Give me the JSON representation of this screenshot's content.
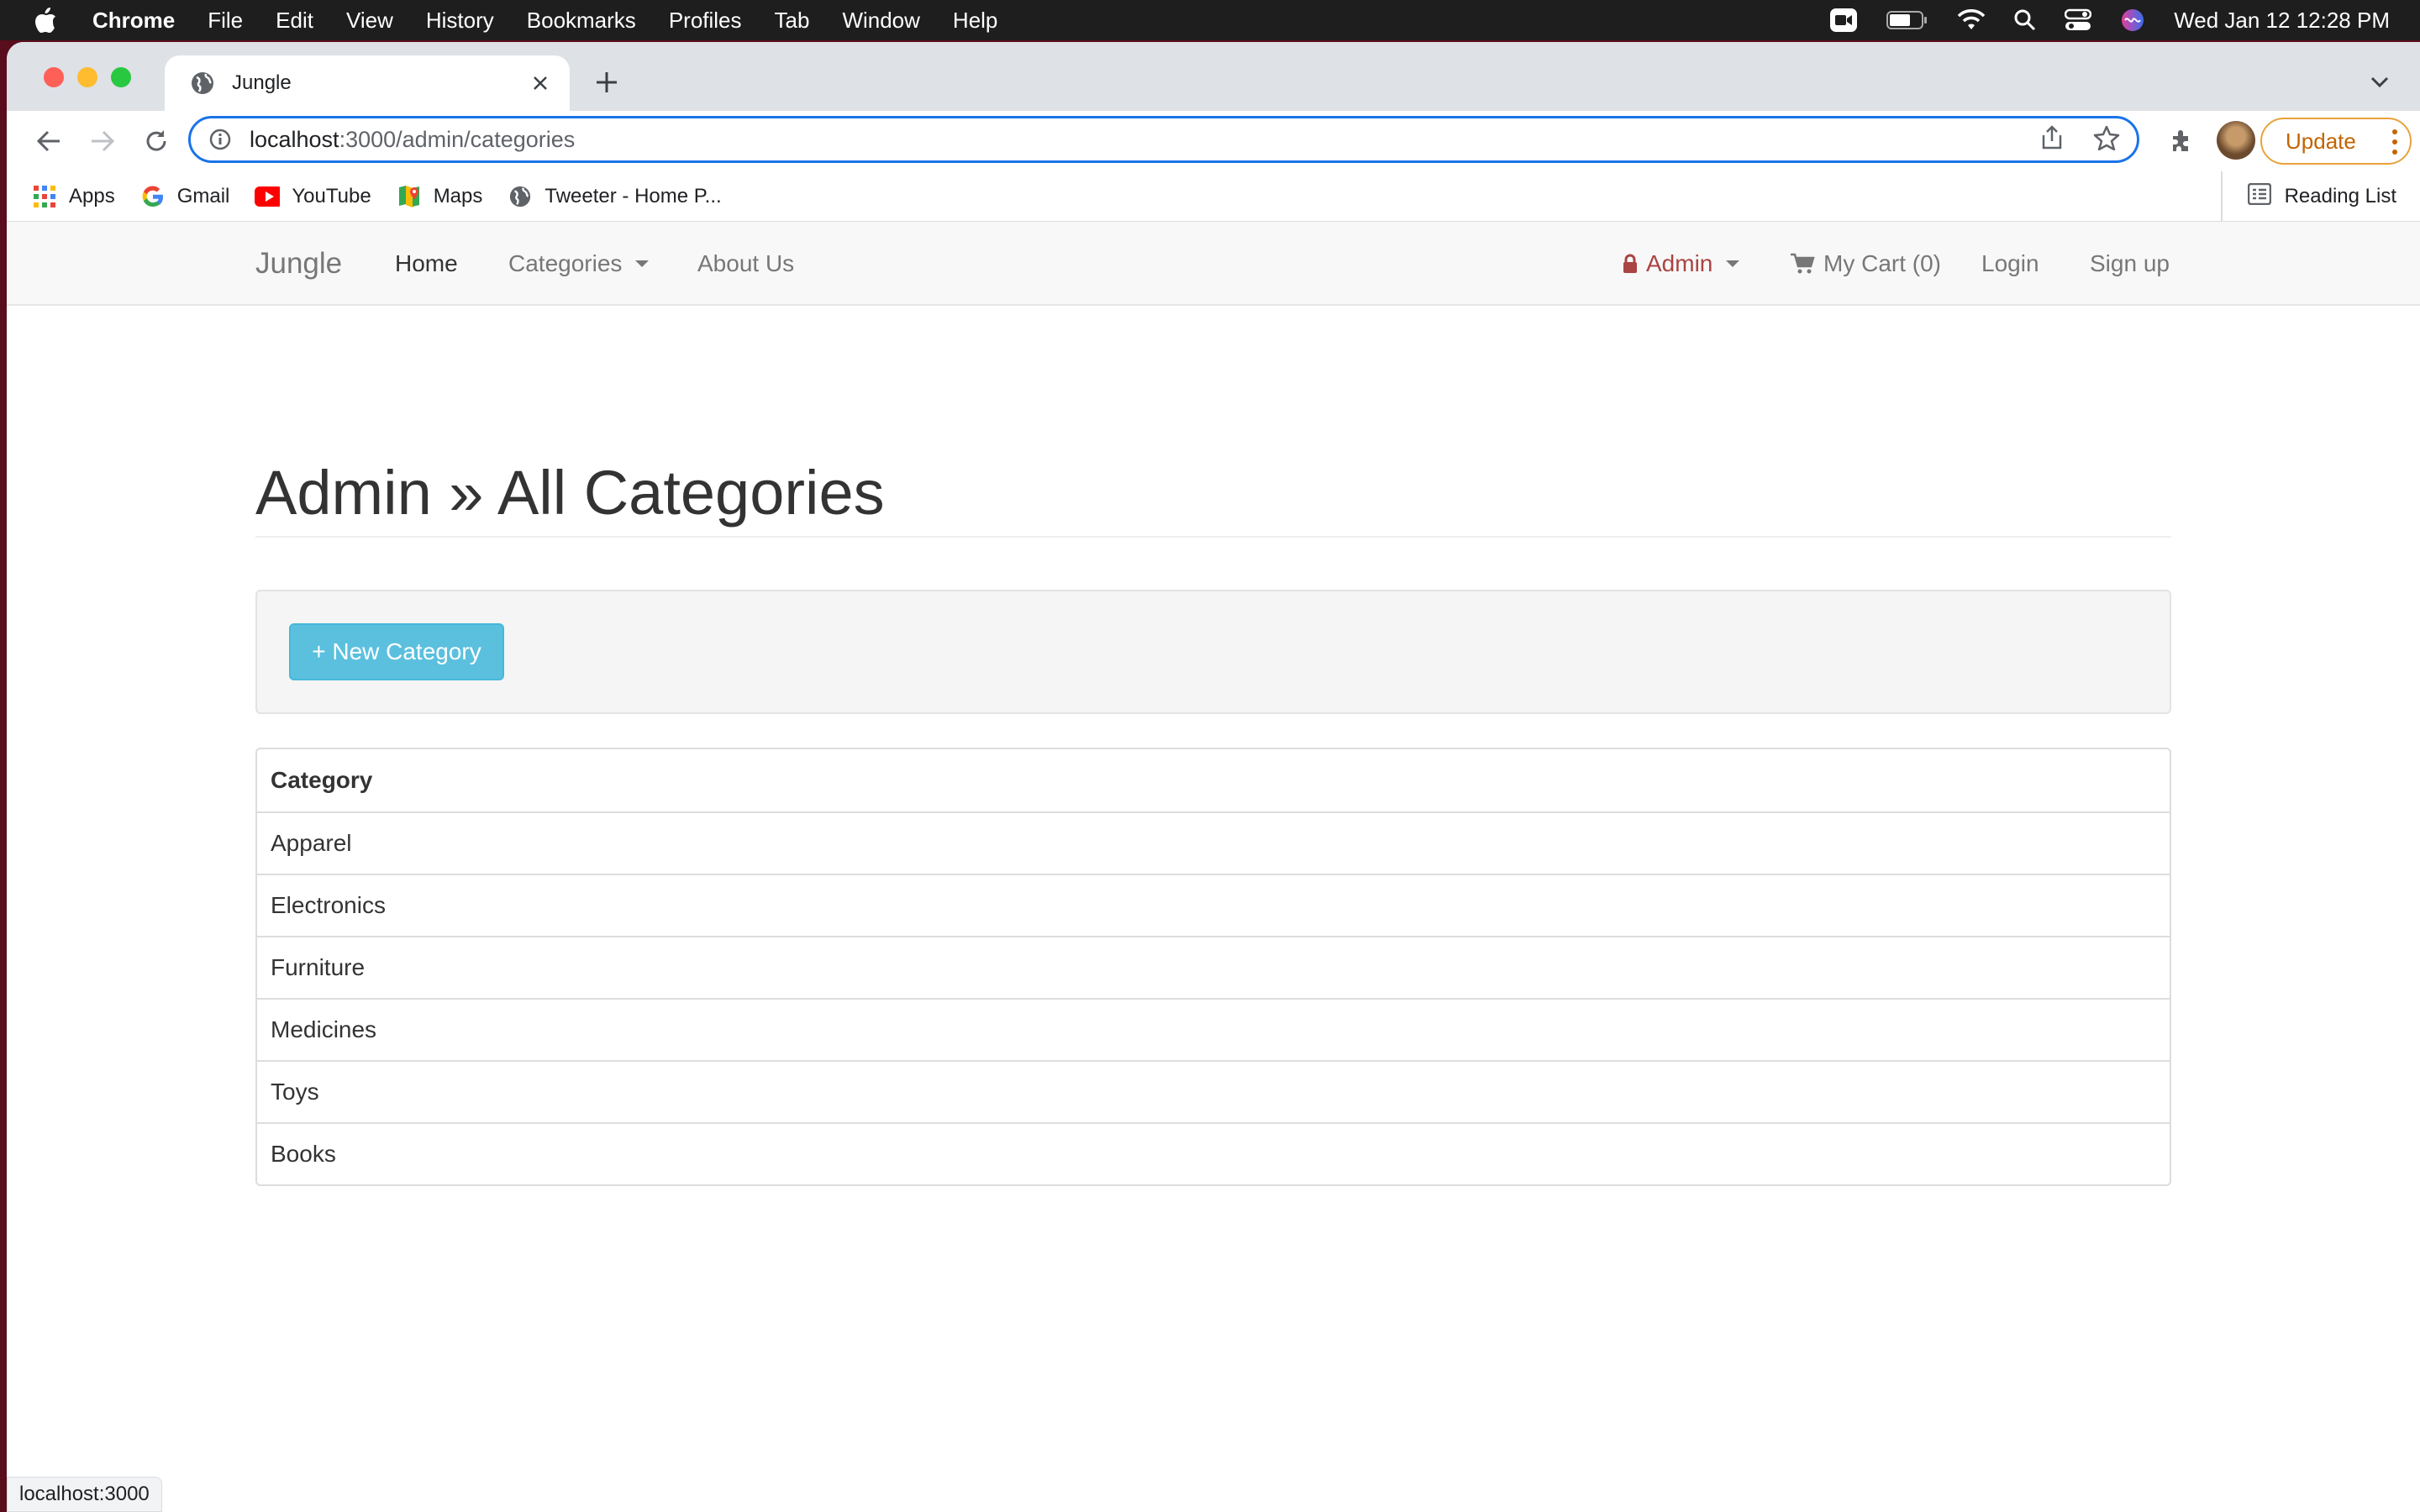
{
  "menubar": {
    "app": "Chrome",
    "items": [
      "File",
      "Edit",
      "View",
      "History",
      "Bookmarks",
      "Profiles",
      "Tab",
      "Window",
      "Help"
    ],
    "clock": "Wed Jan 12  12:28 PM"
  },
  "browser": {
    "tab_title": "Jungle",
    "url_host": "localhost",
    "url_path": ":3000/admin/categories",
    "update_label": "Update",
    "bookmarks": [
      "Apps",
      "Gmail",
      "YouTube",
      "Maps",
      "Tweeter - Home P..."
    ],
    "reading_list": "Reading List",
    "status_url": "localhost:3000"
  },
  "navbar": {
    "brand": "Jungle",
    "home": "Home",
    "categories": "Categories",
    "about": "About Us",
    "admin": "Admin",
    "cart": "My Cart (0)",
    "login": "Login",
    "signup": "Sign up"
  },
  "main": {
    "title": "Admin » All Categories",
    "new_button": "+ New Category",
    "table_header": "Category",
    "categories": [
      "Apparel",
      "Electronics",
      "Furniture",
      "Medicines",
      "Toys",
      "Books"
    ]
  },
  "colors": {
    "accent": "#1a73e8",
    "info_button": "#5bc0de",
    "admin_link": "#a94442",
    "update": "#c26401"
  }
}
